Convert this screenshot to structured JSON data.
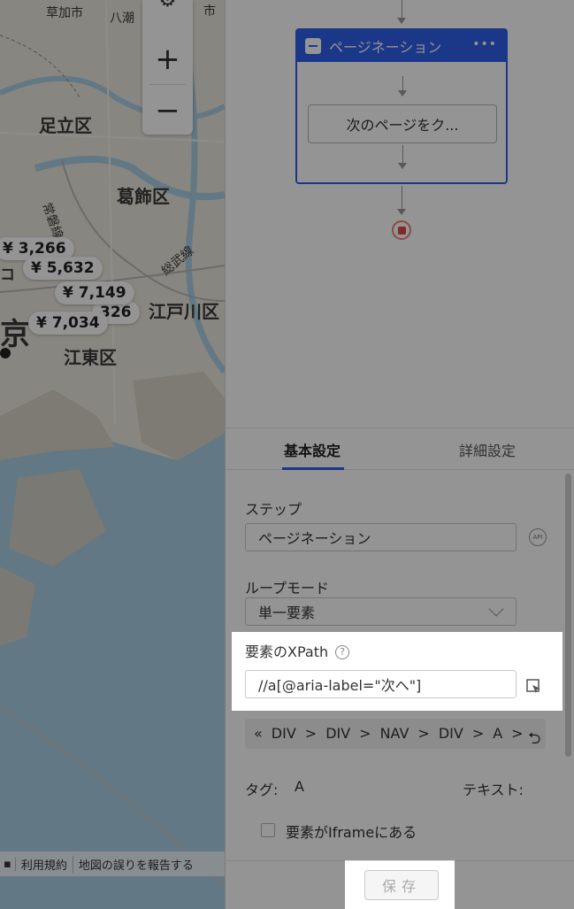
{
  "map": {
    "labels": {
      "soka": "草加市",
      "yashio": "八潮",
      "misato": "市",
      "adachi": "足立区",
      "katsushika": "葛飾区",
      "joban": "常磐線",
      "sobu": "総武線",
      "edogawa": "江戸川区",
      "koto": "江東区",
      "tokyo": "京",
      "koiwa_stub": "コ"
    },
    "prices": [
      "¥ 3,266",
      "¥ 5,632",
      "¥ 7,149",
      "¥ 7,034",
      "326"
    ],
    "zoom_in": "+",
    "zoom_out": "−",
    "footer": {
      "terms": "利用規約",
      "report": "地図の誤りを報告する"
    }
  },
  "flow": {
    "loop_title": "ページネーション",
    "loop_more": "•••",
    "step_label": "次のページをク..."
  },
  "tabs": {
    "basic": "基本設定",
    "advanced": "詳細設定"
  },
  "form": {
    "step_label": "ステップ",
    "step_value": "ページネーション",
    "api": "API",
    "loop_mode_label": "ループモード",
    "loop_mode_value": "単一要素",
    "xpath_label": "要素のXPath",
    "xpath_help": "?",
    "xpath_value": "//a[@aria-label=\"次へ\"]",
    "breadcrumb": [
      "«",
      "DIV",
      ">",
      "DIV",
      ">",
      "NAV",
      ">",
      "DIV",
      ">",
      "A",
      ">"
    ],
    "tag_label": "タグ:",
    "tag_value": "A",
    "text_label": "テキスト:",
    "iframe_label": "要素がIframeにある"
  },
  "footer": {
    "save": "保存"
  }
}
